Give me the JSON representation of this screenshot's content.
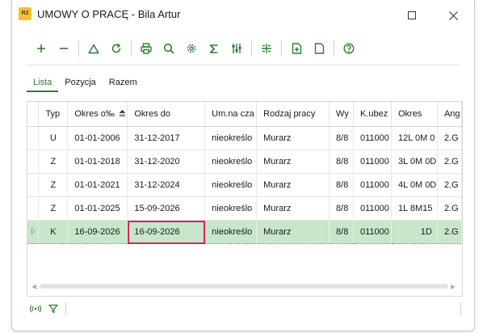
{
  "window": {
    "title": "UMOWY O PRACĘ - Bila Artur",
    "app_icon_text": "R2"
  },
  "toolbar": {
    "icons": [
      "plus-icon",
      "minus-icon",
      "triangle-icon",
      "refresh-icon",
      "print-icon",
      "search-icon",
      "gear-icon",
      "sigma-icon",
      "sliders-icon",
      "columns-icon",
      "add-document-icon",
      "document-icon",
      "help-icon"
    ]
  },
  "tabs": [
    {
      "label": "Lista",
      "active": true
    },
    {
      "label": "Pozycja",
      "active": false
    },
    {
      "label": "Razem",
      "active": false
    }
  ],
  "grid": {
    "columns": [
      "Typ",
      "Okres o‰",
      "Okres do",
      "Um.na cza",
      "Rodzaj pracy",
      "Wy",
      "K.ubez",
      "Okres",
      "Ang"
    ],
    "rows": [
      {
        "typ": "U",
        "od": "01-01-2006",
        "do": "31-12-2017",
        "um": "nieokreślo",
        "rodzaj": "Murarz",
        "wy": "8/8",
        "kubez": "011000",
        "okres": "12L 0M 0",
        "ang": "2.G"
      },
      {
        "typ": "Z",
        "od": "01-01-2018",
        "do": "31-12-2020",
        "um": "nieokreślo",
        "rodzaj": "Murarz",
        "wy": "8/8",
        "kubez": "011000",
        "okres": "3L 0M 0D",
        "ang": "2.G"
      },
      {
        "typ": "Z",
        "od": "01-01-2021",
        "do": "31-12-2024",
        "um": "nieokreślo",
        "rodzaj": "Murarz",
        "wy": "8/8",
        "kubez": "011000",
        "okres": "4L 0M 0D",
        "ang": "2.G"
      },
      {
        "typ": "Z",
        "od": "01-01-2025",
        "do": "15-09-2026",
        "um": "nieokreślo",
        "rodzaj": "Murarz",
        "wy": "8/8",
        "kubez": "011000",
        "okres": "1L 8M15",
        "ang": "2.G"
      },
      {
        "typ": "K",
        "od": "16-09-2026",
        "do": "16-09-2026",
        "um": "nieokreślo",
        "rodzaj": "Murarz",
        "wy": "8/8",
        "kubez": "011000",
        "okres": "1D",
        "ang": "2.G"
      }
    ]
  },
  "colors": {
    "accent": "#2e7d32",
    "selected_row": "#c8e6c9",
    "focus_border": "#d6255c"
  }
}
